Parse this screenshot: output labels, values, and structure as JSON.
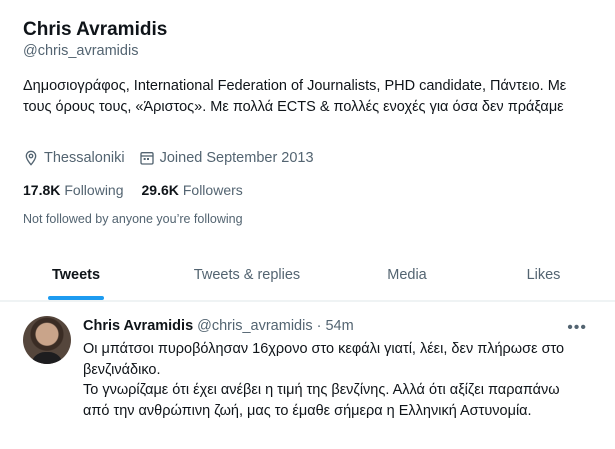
{
  "profile": {
    "display_name": "Chris Avramidis",
    "handle": "@chris_avramidis",
    "bio": "Δημοσιογράφος, International Federation of Journalists, PHD candidate, Πάντειο. Με τους όρους τους, «Άριστος». Με πολλά ECTS & πολλές ενοχές για όσα δεν πράξαμε",
    "location": "Thessaloniki",
    "joined": "Joined September 2013",
    "following_count": "17.8K",
    "following_label": "Following",
    "followers_count": "29.6K",
    "followers_label": "Followers",
    "not_followed": "Not followed by anyone you’re following"
  },
  "tabs": [
    {
      "label": "Tweets",
      "active": true
    },
    {
      "label": "Tweets & replies",
      "active": false
    },
    {
      "label": "Media",
      "active": false
    },
    {
      "label": "Likes",
      "active": false
    }
  ],
  "tweet": {
    "name": "Chris Avramidis",
    "handle": "@chris_avramidis",
    "separator": "·",
    "time": "54m",
    "more": "•••",
    "lines": [
      "Οι μπάτσοι πυροβόλησαν 16χρονο στο κεφάλι γιατί, λέει, δεν πλήρωσε στο βενζινάδικο.",
      "Το γνωρίζαμε ότι έχει ανέβει η τιμή της βενζίνης. Αλλά ότι αξίζει παραπάνω από την ανθρώπινη ζωή, μας το έμαθε σήμερα η Ελληνική Αστυνομία."
    ]
  },
  "icons": {
    "location": "location-pin-icon",
    "calendar": "calendar-icon"
  }
}
